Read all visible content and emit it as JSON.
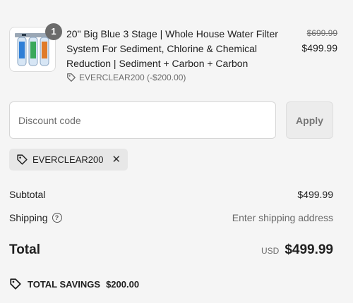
{
  "product": {
    "quantity": "1",
    "title": "20\" Big Blue 3 Stage | Whole House Water Filter System For Sediment, Chlorine & Chemical Reduction | Sediment + Carbon + Carbon",
    "discount_line": "EVERCLEAR200 (-$200.00)",
    "original_price": "$699.99",
    "price": "$499.99",
    "image_icon": "water-filter-product-image"
  },
  "discount": {
    "placeholder": "Discount code",
    "apply_label": "Apply",
    "applied_code": "EVERCLEAR200"
  },
  "summary": {
    "subtotal_label": "Subtotal",
    "subtotal_value": "$499.99",
    "shipping_label": "Shipping",
    "shipping_value": "Enter shipping address",
    "total_label": "Total",
    "currency": "USD",
    "total_value": "$499.99",
    "savings_label": "TOTAL SAVINGS",
    "savings_value": "$200.00"
  },
  "colors": {
    "background": "#f5f5f5",
    "badge": "#6b6b6b",
    "filter_blue": "#2f7fd6",
    "filter_green": "#39a85a",
    "filter_orange": "#e07b2a"
  }
}
